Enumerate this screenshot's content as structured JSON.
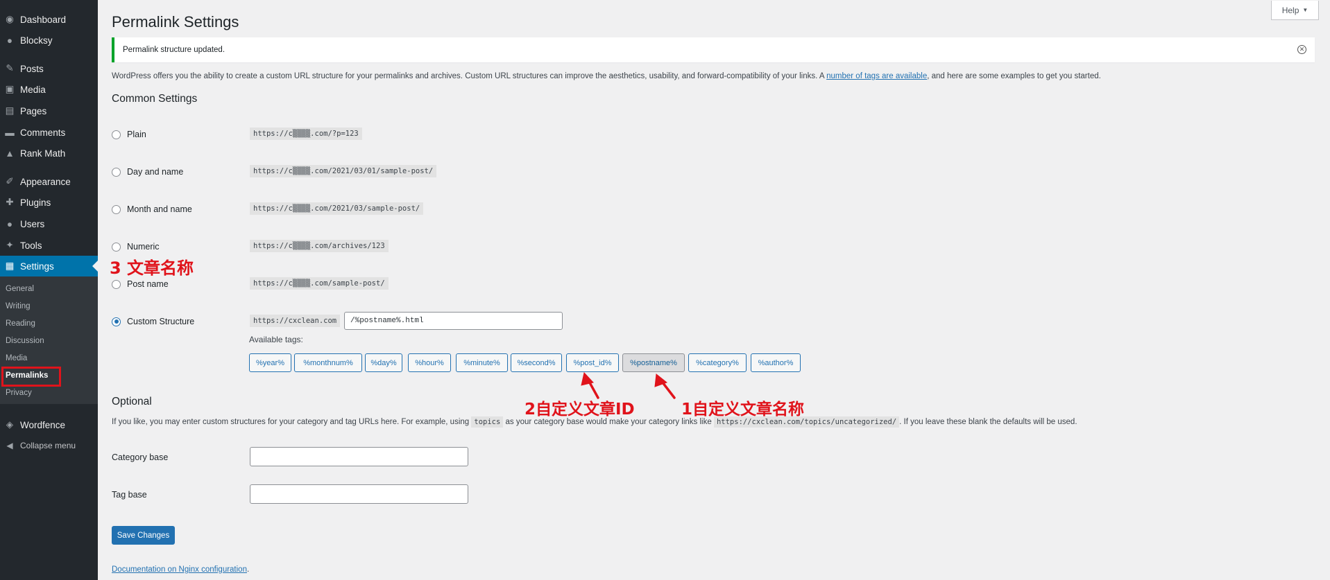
{
  "sidebar": {
    "items": [
      {
        "label": "Dashboard",
        "icon": "dashboard-icon",
        "glyph": "◉"
      },
      {
        "label": "Blocksy",
        "icon": "blocksy-icon",
        "glyph": "●"
      },
      {
        "label": "Posts",
        "icon": "pin-icon",
        "glyph": "✎"
      },
      {
        "label": "Media",
        "icon": "media-icon",
        "glyph": "▣"
      },
      {
        "label": "Pages",
        "icon": "pages-icon",
        "glyph": "▤"
      },
      {
        "label": "Comments",
        "icon": "comment-icon",
        "glyph": "▬"
      },
      {
        "label": "Rank Math",
        "icon": "rank-math-icon",
        "glyph": "▲"
      },
      {
        "label": "Appearance",
        "icon": "appearance-icon",
        "glyph": "✐"
      },
      {
        "label": "Plugins",
        "icon": "plugin-icon",
        "glyph": "✚"
      },
      {
        "label": "Users",
        "icon": "user-icon",
        "glyph": "●"
      },
      {
        "label": "Tools",
        "icon": "wrench-icon",
        "glyph": "✦"
      },
      {
        "label": "Settings",
        "icon": "settings-icon",
        "glyph": "▦"
      }
    ],
    "submenu": [
      "General",
      "Writing",
      "Reading",
      "Discussion",
      "Media",
      "Permalinks",
      "Privacy"
    ],
    "wordfence": {
      "label": "Wordfence",
      "icon": "wordfence-icon",
      "glyph": "◈"
    },
    "collapse": {
      "label": "Collapse menu",
      "icon": "collapse-icon",
      "glyph": "◀"
    }
  },
  "header": {
    "help_label": "Help",
    "help_arrow": "▼",
    "title": "Permalink Settings"
  },
  "notice": {
    "text": "Permalink structure updated.",
    "close_glyph": "✕"
  },
  "intro": {
    "before": "WordPress offers you the ability to create a custom URL structure for your permalinks and archives. Custom URL structures can improve the aesthetics, usability, and forward-compatibility of your links. A ",
    "link": "number of tags are available",
    "after": ", and here are some examples to get you started."
  },
  "common": {
    "title": "Common Settings",
    "options": [
      {
        "label": "Plain",
        "example": "https://c▒▒▒▒.com/?p=123",
        "checked": false
      },
      {
        "label": "Day and name",
        "example": "https://c▒▒▒▒.com/2021/03/01/sample-post/",
        "checked": false
      },
      {
        "label": "Month and name",
        "example": "https://c▒▒▒▒.com/2021/03/sample-post/",
        "checked": false
      },
      {
        "label": "Numeric",
        "example": "https://c▒▒▒▒.com/archives/123",
        "checked": false
      },
      {
        "label": "Post name",
        "example": "https://c▒▒▒▒.com/sample-post/",
        "checked": false
      },
      {
        "label": "Custom Structure",
        "example": "https://cxclean.com",
        "checked": true
      }
    ],
    "custom_value": "/%postname%.html",
    "available_tags_label": "Available tags:",
    "tags": [
      "%year%",
      "%monthnum%",
      "%day%",
      "%hour%",
      "%minute%",
      "%second%",
      "%post_id%",
      "%postname%",
      "%category%",
      "%author%"
    ],
    "active_tag": "%postname%"
  },
  "optional": {
    "title": "Optional",
    "desc_1": "If you like, you may enter custom structures for your category and tag URLs here. For example, using",
    "desc_code_1": "topics",
    "desc_2": "as your category base would make your category links like",
    "desc_code_2": "https://cxclean.com/topics/uncategorized/",
    "desc_3": ". If you leave these blank the defaults will be used.",
    "category_label": "Category base",
    "category_value": "",
    "tag_label": "Tag base",
    "tag_value": ""
  },
  "save_label": "Save Changes",
  "doc_link": "Documentation on Nginx configuration",
  "doc_link_suffix": ".",
  "annotations": {
    "a1": "3 文章名称",
    "a2": "2自定义文章ID",
    "a3": "1自定义文章名称",
    "color": "#e0131b"
  }
}
